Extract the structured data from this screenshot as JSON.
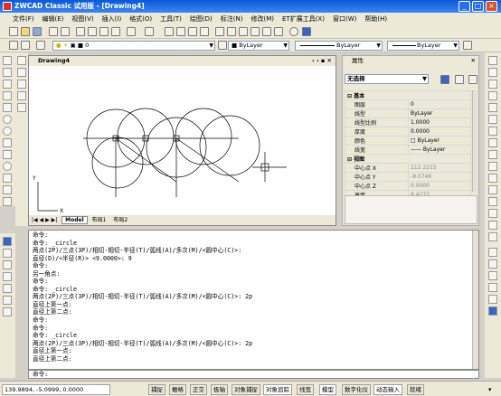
{
  "window": {
    "title": "ZWCAD Classic 试用版 - [Drawing4]"
  },
  "menu": [
    "文件(F)",
    "编辑(E)",
    "视图(V)",
    "插入(I)",
    "格式(O)",
    "工具(T)",
    "绘图(D)",
    "标注(N)",
    "修改(M)",
    "ET扩展工具(X)",
    "窗口(W)",
    "帮助(H)"
  ],
  "toolbar": {
    "layer_value": "0",
    "color_value": "ByLayer",
    "linetype_value": "ByLayer",
    "lineweight_value": "ByLayer"
  },
  "drawing": {
    "title": "Drawing4",
    "axis_x": "X",
    "axis_y": "Y"
  },
  "tabs": [
    "Model",
    "布局1",
    "布局2"
  ],
  "properties": {
    "title": "属性",
    "selection": "无选择",
    "sections": {
      "basic": "基本",
      "view": "视图"
    },
    "rows": [
      {
        "label": "图层",
        "value": "0"
      },
      {
        "label": "线型",
        "value": "ByLayer"
      },
      {
        "label": "线型比例",
        "value": "1.0000"
      },
      {
        "label": "厚度",
        "value": "0.0000"
      },
      {
        "label": "颜色",
        "value": "ByLayer"
      },
      {
        "label": "线宽",
        "value": "—— ByLayer"
      }
    ],
    "view_rows": [
      {
        "label": "中心点 X",
        "value": "112.2215"
      },
      {
        "label": "中心点 Y",
        "value": "-9.0746"
      },
      {
        "label": "中心点 Z",
        "value": "0.0000"
      },
      {
        "label": "高度",
        "value": "9.4272"
      }
    ]
  },
  "command_history": [
    "命令:",
    "命令: _circle",
    "两点(2P)/三点(3P)/相切-相切-半径(T)/弧线(A)/多次(M)/<圆中心(C)>:",
    "直径(D)/<半径(R)> <9.0000>: 9",
    "命令:",
    "另一角点:",
    "命令:",
    "命令: _circle",
    "两点(2P)/三点(3P)/相切-相切-半径(T)/弧线(A)/多次(M)/<圆中心(C)>: 2p",
    "直径上第一点:",
    "直径上第二点:",
    "命令:",
    "命令:",
    "命令: _circle",
    "两点(2P)/三点(3P)/相切-相切-半径(T)/弧线(A)/多次(M)/<圆中心(C)>: 2p",
    "直径上第一点:",
    "直径上第二点:"
  ],
  "command_prompt": "命令:",
  "status": {
    "coords": "139.9894, -5.0999, 0.0000",
    "buttons": [
      "捕捉",
      "栅格",
      "正交",
      "极轴",
      "对象捕捉",
      "对象追踪",
      "线宽",
      "模型",
      "数字化仪",
      "动态输入",
      "就绪"
    ]
  }
}
